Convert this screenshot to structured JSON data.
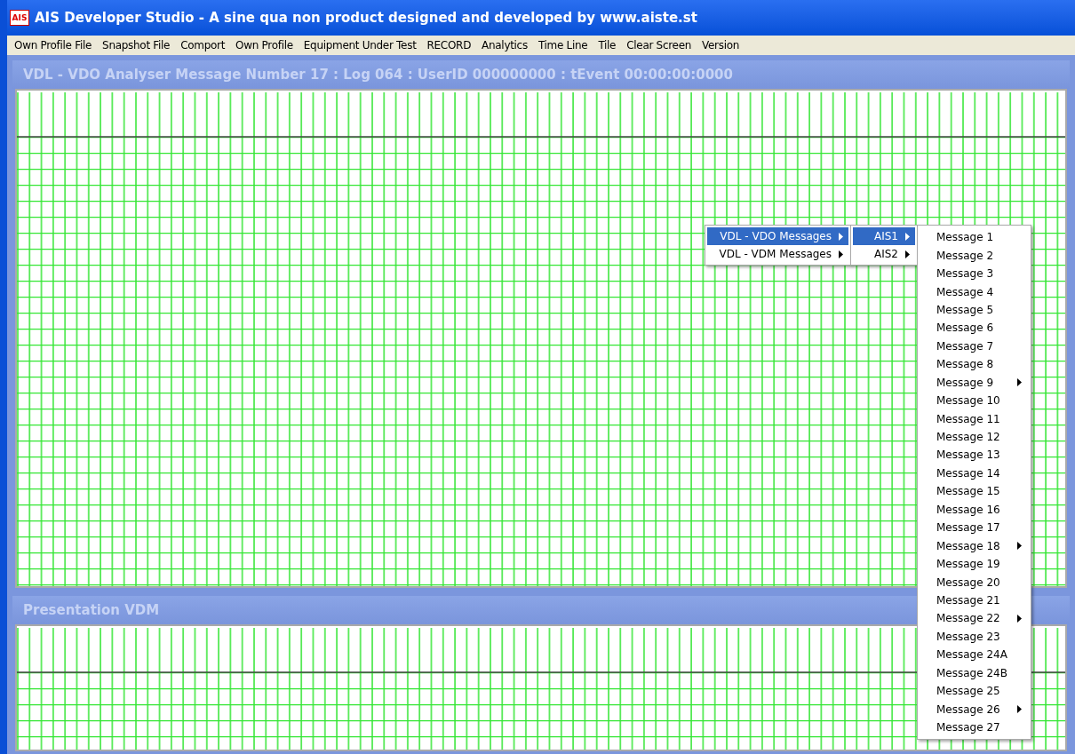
{
  "window": {
    "title": "AIS Developer Studio - A sine qua non product designed and developed by www.aiste.st",
    "icon_text": "AIS"
  },
  "menu_bar": [
    "Own Profile File",
    "Snapshot File",
    "Comport",
    "Own Profile",
    "Equipment Under Test",
    "RECORD",
    "Analytics",
    "Time Line",
    "Tile",
    "Clear Screen",
    "Version"
  ],
  "panels": [
    {
      "title": "VDL - VDO Analyser Message Number 17 : Log 064 : UserID 000000000 : tEvent 00:00:00:0000"
    },
    {
      "title": "Presentation VDM"
    }
  ],
  "context_menu": [
    {
      "label": "VDL - VDO Messages",
      "selected": true,
      "has_submenu": true
    },
    {
      "label": "VDL - VDM Messages",
      "selected": false,
      "has_submenu": true
    }
  ],
  "submenu": [
    {
      "label": "AIS1",
      "selected": true,
      "has_submenu": true
    },
    {
      "label": "AIS2",
      "selected": false,
      "has_submenu": true
    }
  ],
  "message_menu": [
    {
      "label": "Message 1",
      "has_submenu": false
    },
    {
      "label": "Message 2",
      "has_submenu": false
    },
    {
      "label": "Message 3",
      "has_submenu": false
    },
    {
      "label": "Message 4",
      "has_submenu": false
    },
    {
      "label": "Message 5",
      "has_submenu": false
    },
    {
      "label": "Message 6",
      "has_submenu": false
    },
    {
      "label": "Message 7",
      "has_submenu": false
    },
    {
      "label": "Message 8",
      "has_submenu": false
    },
    {
      "label": "Message 9",
      "has_submenu": true
    },
    {
      "label": "Message 10",
      "has_submenu": false
    },
    {
      "label": "Message 11",
      "has_submenu": false
    },
    {
      "label": "Message 12",
      "has_submenu": false
    },
    {
      "label": "Message 13",
      "has_submenu": false
    },
    {
      "label": "Message 14",
      "has_submenu": false
    },
    {
      "label": "Message 15",
      "has_submenu": false
    },
    {
      "label": "Message 16",
      "has_submenu": false
    },
    {
      "label": "Message 17",
      "has_submenu": false
    },
    {
      "label": "Message 18",
      "has_submenu": true
    },
    {
      "label": "Message 19",
      "has_submenu": false
    },
    {
      "label": "Message 20",
      "has_submenu": false
    },
    {
      "label": "Message 21",
      "has_submenu": false
    },
    {
      "label": "Message 22",
      "has_submenu": true
    },
    {
      "label": "Message 23",
      "has_submenu": false
    },
    {
      "label": "Message 24A",
      "has_submenu": false
    },
    {
      "label": "Message 24B",
      "has_submenu": false
    },
    {
      "label": "Message 25",
      "has_submenu": false
    },
    {
      "label": "Message 26",
      "has_submenu": true
    },
    {
      "label": "Message 27",
      "has_submenu": false
    }
  ]
}
